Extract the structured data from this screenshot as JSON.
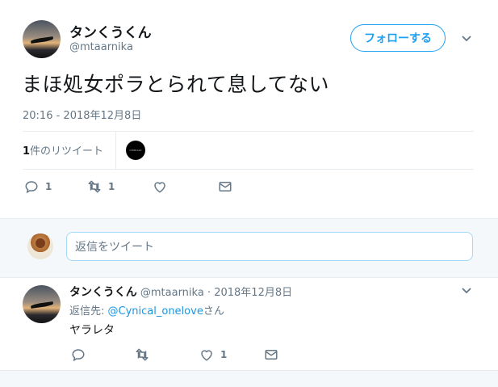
{
  "tweet": {
    "display_name": "タンくうくん",
    "handle": "@mtaarnika",
    "follow_label": "フォローする",
    "text": "まほ処女ポラとられて息してない",
    "timestamp": "20:16 - 2018年12月8日",
    "retweets": {
      "count": "1",
      "label": "件のリツイート"
    },
    "retweeter_avatar_text": "CYNICALX",
    "actions": {
      "reply_count": "1",
      "retweet_count": "1",
      "like_count": ""
    }
  },
  "reply_composer": {
    "placeholder": "返信をツイート"
  },
  "reply": {
    "display_name": "タンくうくん",
    "handle": "@mtaarnika",
    "date": "· 2018年12月8日",
    "reply_to_prefix": "返信先: ",
    "reply_to_user": "@Cynical_onelove",
    "reply_to_suffix": "さん",
    "text": "ヤラレタ",
    "actions": {
      "reply_count": "",
      "retweet_count": "",
      "like_count": "1"
    }
  }
}
